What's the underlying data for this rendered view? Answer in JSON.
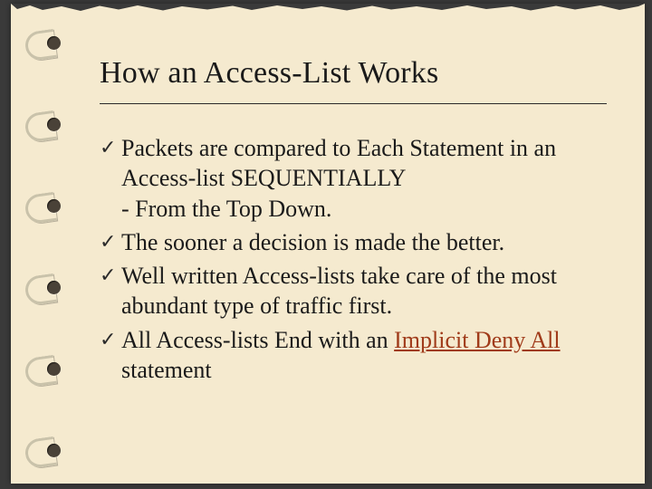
{
  "title": "How an Access-List Works",
  "bullets": {
    "b1_line1": "Packets are compared to Each Statement in an Access-list SEQUENTIALLY",
    "b1_line2": "- From the Top Down.",
    "b2": "The sooner a decision is made the better.",
    "b3": "Well written Access-lists take care of the most abundant type of traffic first.",
    "b4_prefix": "All Access-lists End with an ",
    "b4_emph": "Implicit Deny All",
    "b4_suffix": " statement"
  },
  "marker_glyph": "✓"
}
